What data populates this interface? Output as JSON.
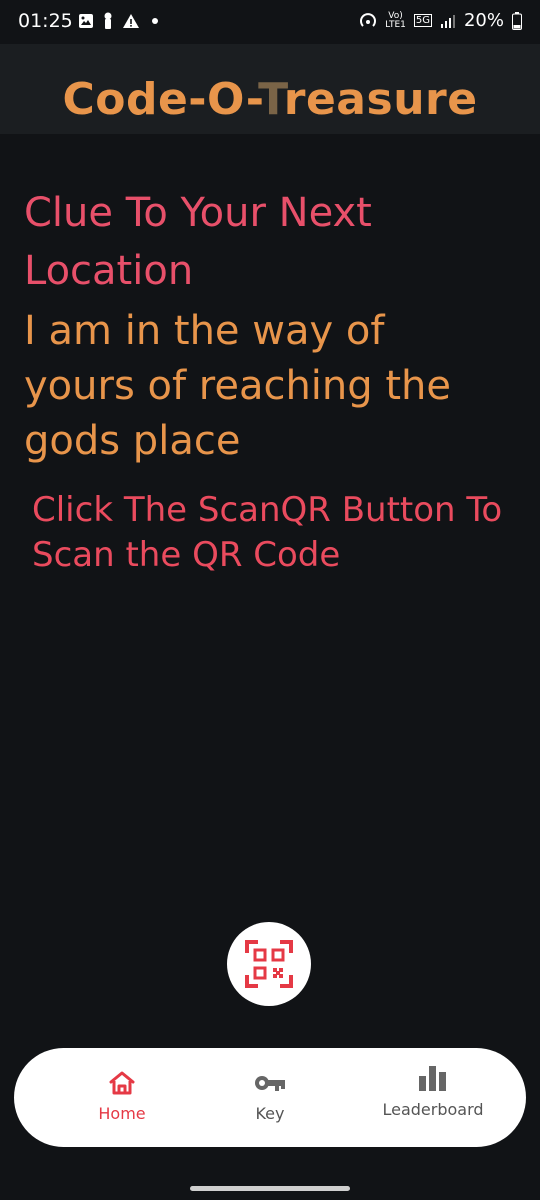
{
  "status": {
    "time": "01:25",
    "battery": "20%",
    "network_top": "Vo)",
    "network_bottom": "LTE1",
    "network_type": "5G"
  },
  "app": {
    "title_part1": "Code-O-",
    "title_part2": "T",
    "title_part3": "reasure"
  },
  "clue": {
    "heading": "Clue To Your Next Location",
    "text": "I am in the way of yours of reaching the gods place"
  },
  "instruction": "Click The ScanQR Button To Scan the QR Code",
  "scan_button": {
    "icon": "qr-code-scan-icon"
  },
  "nav": {
    "items": [
      {
        "label": "Home",
        "icon": "home-icon",
        "active": true
      },
      {
        "label": "Key",
        "icon": "key-icon",
        "active": false
      },
      {
        "label": "Leaderboard",
        "icon": "leaderboard-icon",
        "active": false
      }
    ]
  },
  "colors": {
    "accent": "#e8954b",
    "heading": "#e8506a",
    "instruction": "#ea4b5e",
    "background": "#111316"
  }
}
